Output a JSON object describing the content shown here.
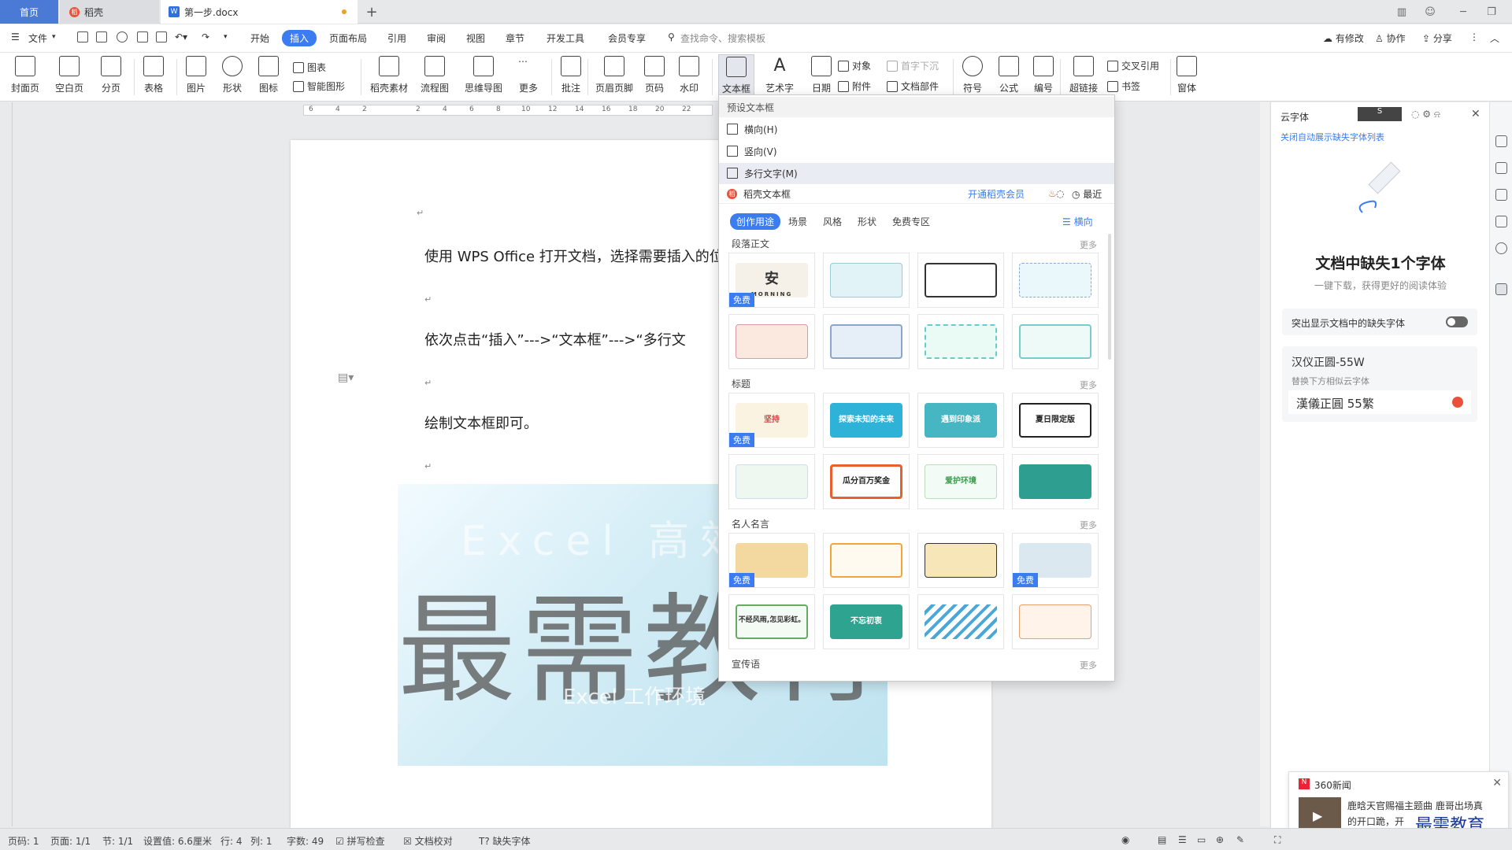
{
  "tabs": {
    "home": "首页",
    "daoke": "稻壳",
    "doc": "第一步.docx",
    "add": "+"
  },
  "menu": {
    "file": "文件",
    "items": [
      "开始",
      "插入",
      "页面布局",
      "引用",
      "审阅",
      "视图",
      "章节",
      "开发工具",
      "会员专享"
    ],
    "search_placeholder": "查找命令、搜索模板",
    "right": [
      "有修改",
      "协作",
      "分享"
    ]
  },
  "ribbon": {
    "big": [
      "封面页",
      "空白页",
      "分页",
      "表格",
      "图片",
      "形状",
      "图标",
      "稻壳素材",
      "流程图",
      "思维导图",
      "更多",
      "批注",
      "页眉页脚",
      "页码",
      "水印",
      "文本框",
      "艺术字",
      "日期",
      "符号",
      "公式",
      "编号",
      "超链接",
      "窗体"
    ],
    "small": [
      "图表",
      "智能图形",
      "对象",
      "首字下沉",
      "附件",
      "文档部件",
      "交叉引用",
      "书签"
    ]
  },
  "document": {
    "paragraphs": [
      "使用 WPS Office 打开文档，选择需要插入的位",
      "依次点击“插入”--->“文本框”--->“多行文",
      "绘制文本框即可。"
    ],
    "watermark_big": "最需教育",
    "watermark_en": "Excel 高效",
    "watermark_sub": "Excel 工作环境"
  },
  "ruler_ticks": [
    "6",
    "4",
    "2",
    "2",
    "4",
    "6",
    "8",
    "10",
    "12",
    "14",
    "16",
    "18",
    "20",
    "22"
  ],
  "dropdown": {
    "header": "预设文本框",
    "options": [
      "横向(H)",
      "竖向(V)",
      "多行文字(M)"
    ],
    "daoke_label": "稻壳文本框",
    "vip_link": "开通稻壳会员",
    "recent": "最近",
    "categories": [
      "创作用途",
      "场景",
      "风格",
      "形状",
      "免费专区"
    ],
    "orientation": "横向",
    "more": "更多",
    "free_badge": "免费",
    "sections": [
      {
        "title": "段落正文"
      },
      {
        "title": "标题"
      },
      {
        "title": "名人名言"
      },
      {
        "title": "宣传语"
      }
    ],
    "title_templates": [
      "坚持",
      "探索未知的未来",
      "遇到印象派",
      "夏日限定版",
      "",
      "瓜分百万奖金",
      "爱护环境",
      ""
    ],
    "morning_text": "MORNING",
    "quote_tpl_texts": [
      "不经风雨,怎见彩虹。",
      "不忘初衷"
    ]
  },
  "right_panel": {
    "title": "云字体",
    "close_link": "关闭自动展示缺失字体列表",
    "missing_title": "文档中缺失1个字体",
    "missing_sub": "一键下载，获得更好的阅读体验",
    "toggle_label": "突出显示文档中的缺失字体",
    "font_name": "汉仪正圆-55W",
    "replace_hint": "替换下方相似云字体",
    "font_sample": "漢儀正圓 55繁"
  },
  "news": {
    "source": "360新闻",
    "line1": "鹿晗天官赐福主题曲 鹿哥出场真",
    "line2": "的开口跪，开",
    "brand": "最需教育"
  },
  "status": {
    "items": [
      "页码: 1",
      "页面: 1/1",
      "节: 1/1",
      "设置值: 6.6厘米",
      "行: 4",
      "列: 1",
      "字数: 49",
      "拼写检查",
      "文档校对",
      "缺失字体"
    ]
  },
  "colors": {
    "accent": "#3b7cf0",
    "hometab": "#4a7ad6",
    "daoke": "#e8523b"
  }
}
